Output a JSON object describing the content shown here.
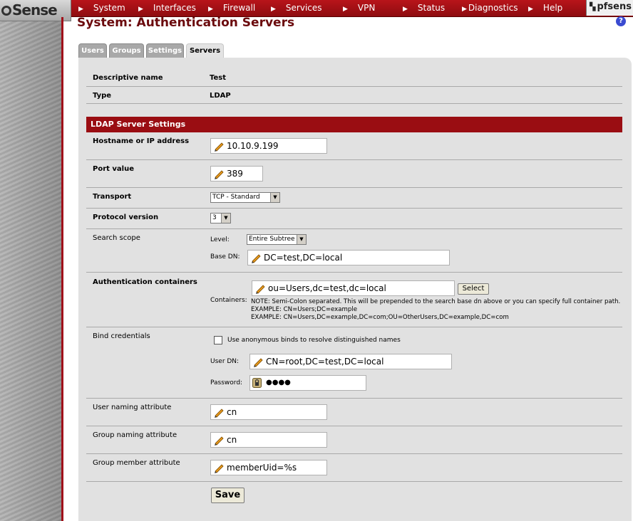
{
  "nav": {
    "logo": "Sense",
    "brand": "pfsens",
    "items": [
      "System",
      "Interfaces",
      "Firewall",
      "Services",
      "VPN",
      "Status",
      "Diagnostics",
      "Help"
    ]
  },
  "page": {
    "title": "System: Authentication Servers",
    "help": "?"
  },
  "tabs": [
    {
      "label": "Users",
      "active": false
    },
    {
      "label": "Groups",
      "active": false
    },
    {
      "label": "Settings",
      "active": false
    },
    {
      "label": "Servers",
      "active": true
    }
  ],
  "form": {
    "descriptive_name_label": "Descriptive name",
    "descriptive_name_value": "Test",
    "type_label": "Type",
    "type_value": "LDAP",
    "section_title": "LDAP Server Settings",
    "hostname_label": "Hostname or IP address",
    "hostname_value": "10.10.9.199",
    "port_label": "Port value",
    "port_value": "389",
    "transport_label": "Transport",
    "transport_value": "TCP - Standard",
    "protocol_label": "Protocol version",
    "protocol_value": "3",
    "scope_label": "Search scope",
    "level_label": "Level:",
    "level_value": "Entire Subtree",
    "basedn_label": "Base DN:",
    "basedn_value": "DC=test,DC=local",
    "containers_section_label": "Authentication containers",
    "containers_label": "Containers:",
    "containers_value": "ou=Users,dc=test,dc=local",
    "select_button": "Select",
    "note_line1": "NOTE: Semi-Colon separated. This will be prepended to the search base dn above or you can specify full container path.",
    "note_line2": "EXAMPLE: CN=Users;DC=example",
    "note_line3": "EXAMPLE: CN=Users,DC=example,DC=com;OU=OtherUsers,DC=example,DC=com",
    "bind_label": "Bind credentials",
    "anon_label": "Use anonymous binds to resolve distinguished names",
    "userdn_label": "User DN:",
    "userdn_value": "CN=root,DC=test,DC=local",
    "password_label": "Password:",
    "password_value": "●●●●",
    "user_attr_label": "User naming attribute",
    "user_attr_value": "cn",
    "group_attr_label": "Group naming attribute",
    "group_attr_value": "cn",
    "member_attr_label": "Group member attribute",
    "member_attr_value": "memberUid=%s",
    "save_button": "Save"
  }
}
